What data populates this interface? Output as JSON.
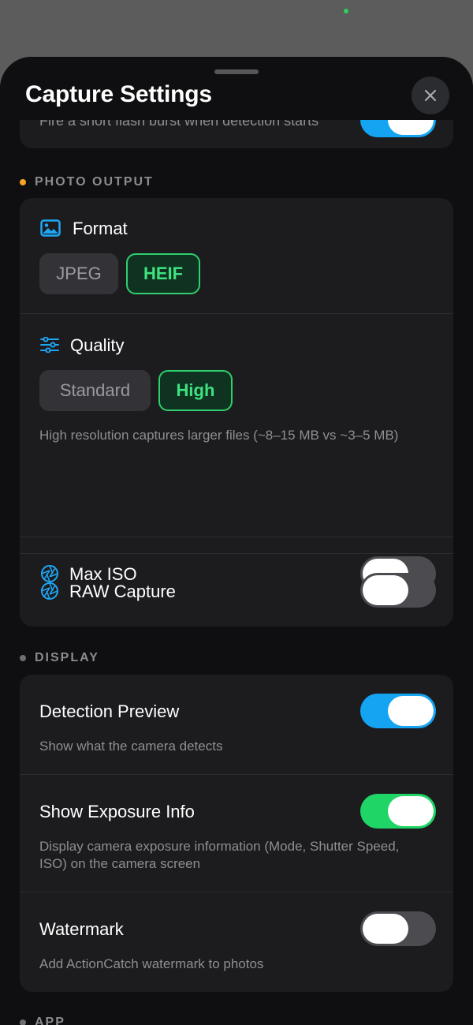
{
  "header": {
    "title": "Capture Settings",
    "close_icon": "close-icon"
  },
  "top_card": {
    "subtitle": "Fire a short flash burst when detection starts",
    "toggle_on": true
  },
  "photo_output": {
    "label": "PHOTO OUTPUT",
    "dot_color": "#f5a524",
    "format": {
      "title": "Format",
      "icon": "image-icon",
      "options": [
        "JPEG",
        "HEIF"
      ],
      "selected": "HEIF"
    },
    "quality": {
      "title": "Quality",
      "icon": "sliders-icon",
      "options": [
        "Standard",
        "High"
      ],
      "selected": "High",
      "description": "High resolution captures larger files (~8–15 MB vs ~3–5 MB)"
    },
    "max_iso": {
      "title": "Max ISO",
      "icon": "aperture-icon",
      "on": false
    },
    "raw_capture": {
      "title": "RAW Capture",
      "icon": "aperture-icon",
      "on": false
    }
  },
  "display": {
    "label": "DISPLAY",
    "dot_color": "#6e6e73",
    "detection_preview": {
      "title": "Detection Preview",
      "subtitle": "Show what the camera detects",
      "on": true,
      "color": "#14a4f2"
    },
    "exposure_info": {
      "title": "Show Exposure Info",
      "subtitle": "Display camera exposure information (Mode, Shutter Speed, ISO) on the camera screen",
      "on": true,
      "color": "#1fd566"
    },
    "watermark": {
      "title": "Watermark",
      "subtitle": "Add ActionCatch watermark to photos",
      "on": false
    }
  },
  "next_section": {
    "label": "APP"
  }
}
